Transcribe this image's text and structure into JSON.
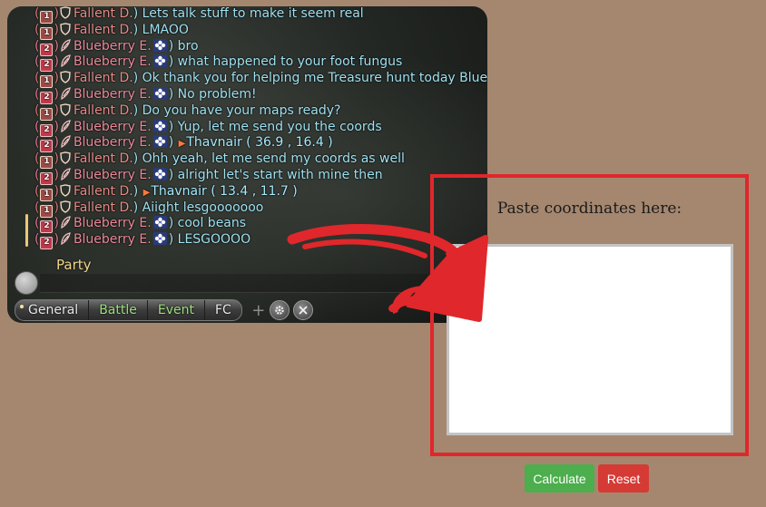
{
  "chat": {
    "messages": [
      {
        "party": "1",
        "sender": "Fallent D.",
        "text": "Lets talk stuff to make it seem real"
      },
      {
        "party": "1",
        "sender": "Fallent D.",
        "text": "LMAOO"
      },
      {
        "party": "2",
        "sender": "Blueberry E.",
        "text": "bro"
      },
      {
        "party": "2",
        "sender": "Blueberry E.",
        "text": "what happened to your foot fungus"
      },
      {
        "party": "1",
        "sender": "Fallent D.",
        "text": "Ok thank you for helping me Treasure hunt today Blue"
      },
      {
        "party": "2",
        "sender": "Blueberry E.",
        "text": "No problem!"
      },
      {
        "party": "1",
        "sender": "Fallent D.",
        "text": "Do you have your maps ready?"
      },
      {
        "party": "2",
        "sender": "Blueberry E.",
        "text": "Yup, let me send you the coords"
      },
      {
        "party": "2",
        "sender": "Blueberry E.",
        "text": "",
        "coords": "Thavnair ( 36.9  , 16.4 )"
      },
      {
        "party": "1",
        "sender": "Fallent D.",
        "text": "Ohh yeah, let me send my coords as well"
      },
      {
        "party": "2",
        "sender": "Blueberry E.",
        "text": "alright let's start with mine then"
      },
      {
        "party": "1",
        "sender": "Fallent D.",
        "text": "",
        "coords": "Thavnair ( 13.4  , 11.7 )"
      },
      {
        "party": "1",
        "sender": "Fallent D.",
        "text": "Aiight lesgooooooo"
      },
      {
        "party": "2",
        "sender": "Blueberry E.",
        "text": "cool beans"
      },
      {
        "party": "2",
        "sender": "Blueberry E.",
        "text": "LESGOOOO"
      }
    ],
    "channel_label": "Party",
    "tabs": [
      "General",
      "Battle",
      "Event",
      "FC"
    ],
    "plus_label": "+"
  },
  "panel": {
    "title": "Paste coordinates here:",
    "textarea_value": ""
  },
  "buttons": {
    "calculate": "Calculate",
    "reset": "Reset"
  },
  "colors": {
    "background": "#a5876f",
    "panel_border": "#e0272b",
    "arrow": "#e0272b",
    "calculate": "#4cae4c",
    "reset": "#d53a35",
    "message_text": "#9fe2f2",
    "party1_name": "#e98b86",
    "party2_name": "#ec8a9b"
  },
  "icons": {
    "tank": "shield-role-icon",
    "healer": "feather-role-icon",
    "flower": "flower-icon",
    "map_flag": "map-flag-icon",
    "speech": "speech-bubble-icon",
    "settings": "gear-icon",
    "close": "close-icon"
  }
}
